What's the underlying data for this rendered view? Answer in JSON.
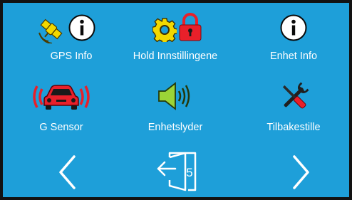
{
  "menu": {
    "items": [
      {
        "label": "GPS Info",
        "icon": "satellite-info-icon"
      },
      {
        "label": "Hold Innstillingene",
        "icon": "gear-lock-icon"
      },
      {
        "label": "Enhet Info",
        "icon": "info-icon"
      },
      {
        "label": "G Sensor",
        "icon": "car-vibration-icon"
      },
      {
        "label": "Enhetslyder",
        "icon": "speaker-icon"
      },
      {
        "label": "Tilbakestille",
        "icon": "wrench-screwdriver-icon"
      }
    ]
  },
  "navigation": {
    "exit_badge": "5",
    "prev_icon": "chevron-left-icon",
    "next_icon": "chevron-right-icon",
    "exit_icon": "exit-door-icon"
  },
  "colors": {
    "background": "#1e9fd9",
    "text": "#ffffff",
    "icon_yellow": "#f2d800",
    "icon_red": "#e8202a",
    "speaker_green": "#9bd437"
  }
}
